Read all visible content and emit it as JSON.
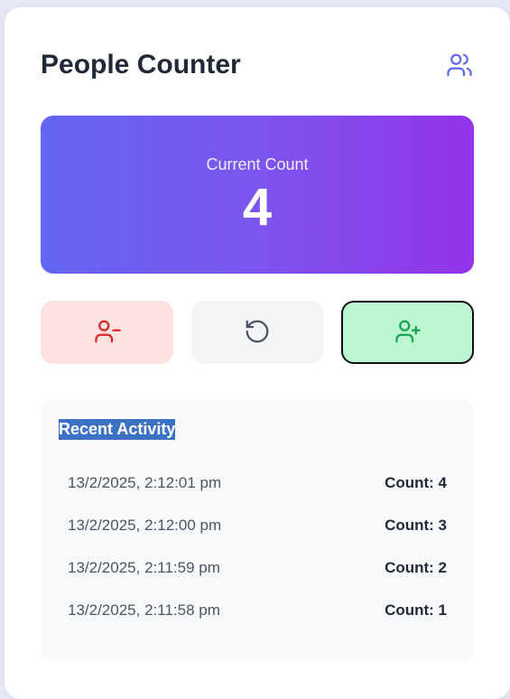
{
  "header": {
    "title": "People Counter",
    "icon": "users-icon"
  },
  "counter": {
    "label": "Current Count",
    "value": "4"
  },
  "buttons": {
    "remove_icon": "user-minus-icon",
    "reset_icon": "rotate-ccw-icon",
    "add_icon": "user-plus-icon"
  },
  "activity": {
    "title": "Recent Activity",
    "items": [
      {
        "time": "13/2/2025, 2:12:01 pm",
        "count": "Count: 4"
      },
      {
        "time": "13/2/2025, 2:12:00 pm",
        "count": "Count: 3"
      },
      {
        "time": "13/2/2025, 2:11:59 pm",
        "count": "Count: 2"
      },
      {
        "time": "13/2/2025, 2:11:58 pm",
        "count": "Count: 1"
      }
    ]
  },
  "colors": {
    "accent": "#6366f1",
    "gradient_end": "#9333ea",
    "remove_bg": "#fee2e2",
    "remove_fg": "#dc2626",
    "reset_bg": "#f3f4f6",
    "add_bg": "#bbf7d0",
    "add_fg": "#16a34a",
    "selection": "#3b72c4"
  }
}
